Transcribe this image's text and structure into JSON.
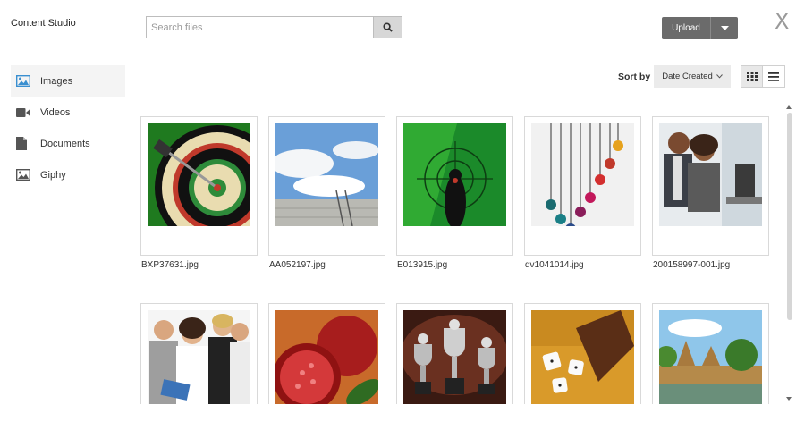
{
  "app": {
    "title": "Content Studio",
    "close_glyph": "X"
  },
  "search": {
    "placeholder": "Search files",
    "value": ""
  },
  "upload": {
    "label": "Upload"
  },
  "sidebar": {
    "items": [
      {
        "label": "Images",
        "icon": "image-icon",
        "active": true
      },
      {
        "label": "Videos",
        "icon": "video-camera-icon",
        "active": false
      },
      {
        "label": "Documents",
        "icon": "document-icon",
        "active": false
      },
      {
        "label": "Giphy",
        "icon": "gif-image-icon",
        "active": false
      }
    ]
  },
  "sort": {
    "label": "Sort by",
    "selected": "Date Created"
  },
  "view_modes": {
    "selected": "grid"
  },
  "files": [
    {
      "name": "BXP37631.jpg",
      "subject": "dartboard"
    },
    {
      "name": "AA052197.jpg",
      "subject": "sky-wall-ladder"
    },
    {
      "name": "E013915.jpg",
      "subject": "green-target"
    },
    {
      "name": "dv1041014.jpg",
      "subject": "hanging-baubles"
    },
    {
      "name": "200158997-001.jpg",
      "subject": "office-people"
    },
    {
      "name": "",
      "subject": "group-portrait"
    },
    {
      "name": "",
      "subject": "pomegranate"
    },
    {
      "name": "",
      "subject": "trophies"
    },
    {
      "name": "",
      "subject": "dice-cup"
    },
    {
      "name": "",
      "subject": "temple-river"
    }
  ],
  "colors": {
    "accent_button": "#6b6b6b",
    "active_nav": "#f4f4f4"
  }
}
